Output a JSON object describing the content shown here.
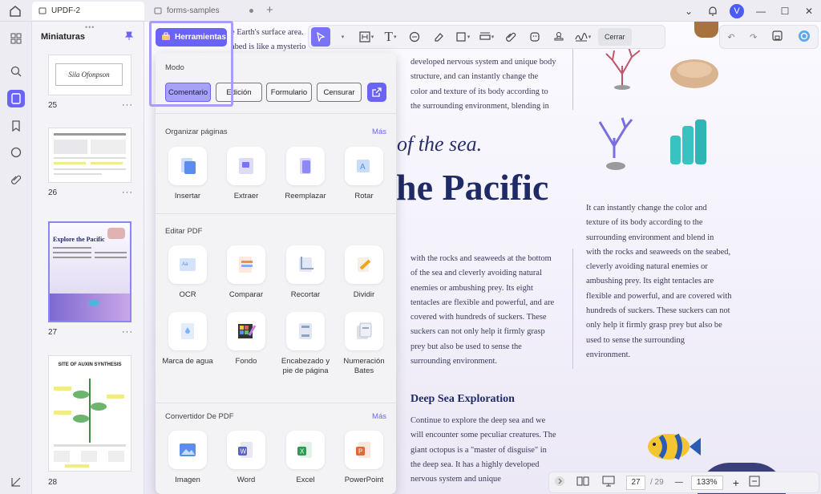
{
  "tabs": [
    {
      "label": "UPDF-2"
    },
    {
      "label": "forms-samples"
    }
  ],
  "user": {
    "initial": "V"
  },
  "sidebar": {
    "title": "Miniaturas"
  },
  "thumbnails": [
    {
      "page": "25",
      "caption": "Sila Ofonpson"
    },
    {
      "page": "26"
    },
    {
      "page": "27",
      "caption": "Explore the Pacific"
    },
    {
      "page": "28",
      "caption": "SITE OF AUXIN SYNTHESIS"
    }
  ],
  "toolbar": {
    "herramientas": "Herramientas",
    "close": "Cerrar"
  },
  "panel": {
    "mode_label": "Modo",
    "modes": [
      "Comentario",
      "Edición",
      "Formulario",
      "Censurar"
    ],
    "organize": {
      "label": "Organizar páginas",
      "more": "Más",
      "items": [
        "Insertar",
        "Extraer",
        "Reemplazar",
        "Rotar"
      ]
    },
    "edit": {
      "label": "Editar PDF",
      "items": [
        "OCR",
        "Comparar",
        "Recortar",
        "Dividir",
        "Marca de agua",
        "Fondo",
        "Encabezado y pie de página",
        "Numeración Bates"
      ]
    },
    "convert": {
      "label": "Convertidor De PDF",
      "more": "Más",
      "items": [
        "Imagen",
        "Word",
        "Excel",
        "PowerPoint"
      ]
    }
  },
  "document": {
    "snippet1": "e Earth's surface area.",
    "snippet2": "abed is like a mysterio",
    "col1_top": [
      "developed nervous system and unique body",
      "structure, and can instantly change the",
      "color and texture of its body according to",
      "the surrounding environment, blending in"
    ],
    "italic_heading": "of the sea.",
    "main_heading": "he Pacific",
    "col1_mid": [
      "with the rocks and seaweeds at the bottom",
      "of the sea and cleverly avoiding natural",
      "enemies or ambushing prey. Its eight",
      "tentacles are flexible and powerful, and are",
      "covered with hundreds of suckers. These",
      "suckers can not only help it firmly grasp",
      "prey but also be used to sense the",
      "surrounding environment."
    ],
    "section_title": "Deep Sea Exploration",
    "col1_bottom": [
      "Continue to explore the deep sea and we",
      "will encounter some peculiar creatures. The",
      "giant octopus is a \"master of disguise\" in",
      "the deep sea. It has a highly developed",
      "nervous system and unique"
    ],
    "col2": [
      "It can instantly change the color and",
      "texture of its body according to the",
      "surrounding environment and blend in",
      "with the rocks and seaweeds on the seabed,",
      "cleverly avoiding natural enemies or",
      "ambushing prey. Its eight tentacles are",
      "flexible and powerful, and are covered with",
      "hundreds of suckers. These suckers can not",
      "only help it firmly grasp prey but also be",
      "used to sense the surrounding",
      "environment."
    ]
  },
  "status": {
    "page": "27",
    "total": "/ 29",
    "zoom": "133%"
  }
}
